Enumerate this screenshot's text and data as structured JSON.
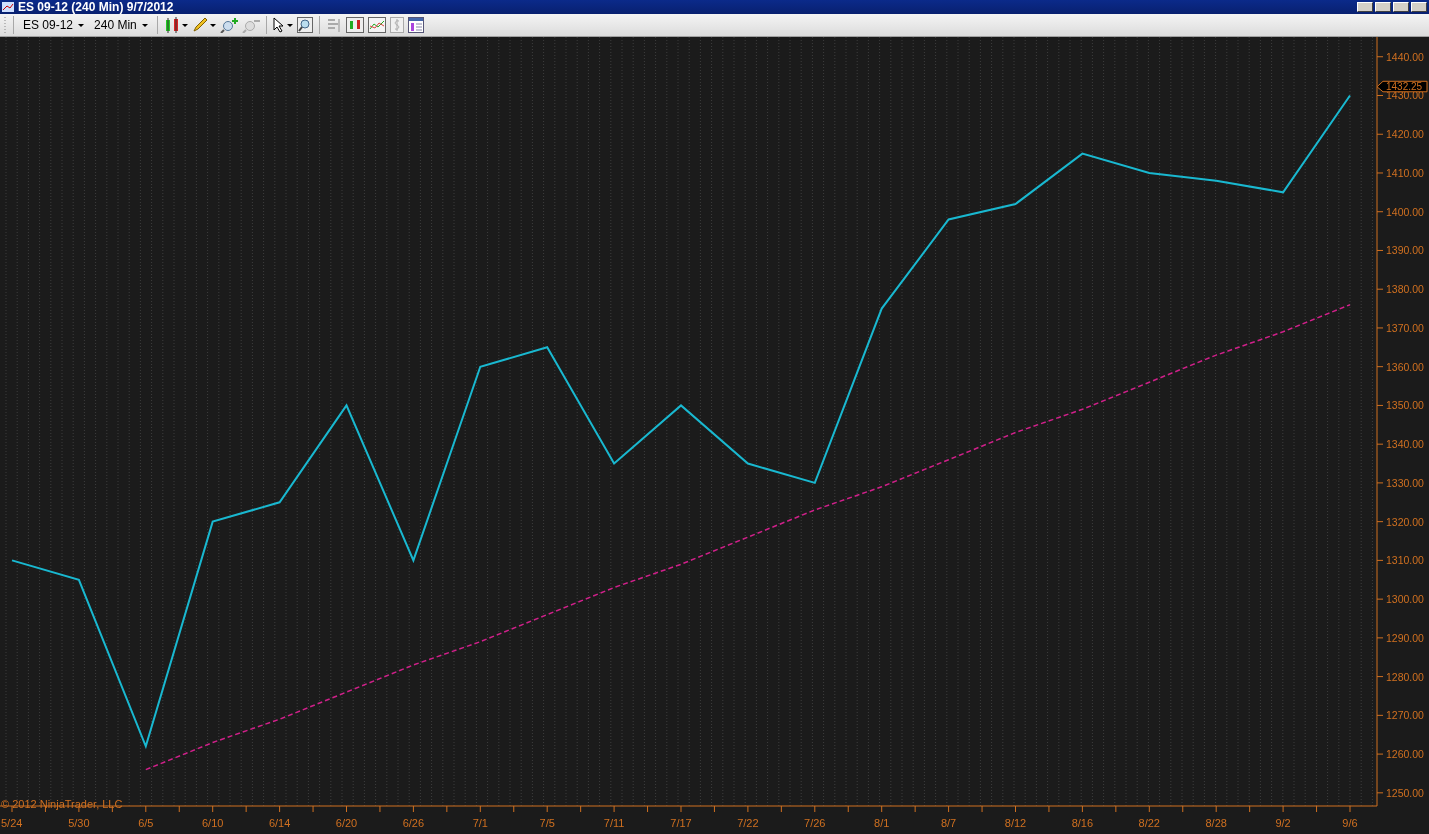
{
  "window": {
    "title": "ES 09-12 (240 Min)  9/7/2012"
  },
  "toolbar": {
    "instrument": "ES 09-12",
    "interval": "240 Min"
  },
  "chart": {
    "last_price": "1432.25",
    "copyright": "© 2012 NinjaTrader, LLC",
    "chart_data": {
      "type": "line",
      "categories": [
        "5/24",
        "5/30",
        "6/5",
        "6/10",
        "6/14",
        "6/20",
        "6/26",
        "7/1",
        "7/5",
        "7/11",
        "7/17",
        "7/22",
        "7/26",
        "8/1",
        "8/7",
        "8/12",
        "8/16",
        "8/22",
        "8/28",
        "9/2",
        "9/6"
      ],
      "series": [
        {
          "color": "#19b8d0",
          "line_style": "solid",
          "values": [
            1310,
            1305,
            1262,
            1320,
            1325,
            1350,
            1310,
            1360,
            1365,
            1335,
            1350,
            1335,
            1330,
            1375,
            1398,
            1402,
            1415,
            1410,
            1408,
            1405,
            1430
          ]
        },
        {
          "color": "#d0208a",
          "line_style": "dashed",
          "values": [
            null,
            null,
            1256,
            1263,
            1269,
            1276,
            1283,
            1289,
            1296,
            1303,
            1309,
            1316,
            1323,
            1329,
            1336,
            1343,
            1349,
            1356,
            1363,
            1369,
            1376
          ]
        }
      ],
      "grid": true,
      "ylim": [
        1246.6,
        1445.1
      ],
      "yticks": [
        {
          "value": 1250,
          "label": "1250.00"
        },
        {
          "value": 1260,
          "label": "1260.00"
        },
        {
          "value": 1270,
          "label": "1270.00"
        },
        {
          "value": 1280,
          "label": "1280.00"
        },
        {
          "value": 1290,
          "label": "1290.00"
        },
        {
          "value": 1300,
          "label": "1300.00"
        },
        {
          "value": 1310,
          "label": "1310.00"
        },
        {
          "value": 1320,
          "label": "1320.00"
        },
        {
          "value": 1330,
          "label": "1330.00"
        },
        {
          "value": 1340,
          "label": "1340.00"
        },
        {
          "value": 1350,
          "label": "1350.00"
        },
        {
          "value": 1360,
          "label": "1360.00"
        },
        {
          "value": 1370,
          "label": "1370.00"
        },
        {
          "value": 1380,
          "label": "1380.00"
        },
        {
          "value": 1390,
          "label": "1390.00"
        },
        {
          "value": 1400,
          "label": "1400.00"
        },
        {
          "value": 1410,
          "label": "1410.00"
        },
        {
          "value": 1420,
          "label": "1420.00"
        },
        {
          "value": 1430,
          "label": "1430.00"
        },
        {
          "value": 1440,
          "label": "1440.00"
        }
      ]
    }
  }
}
